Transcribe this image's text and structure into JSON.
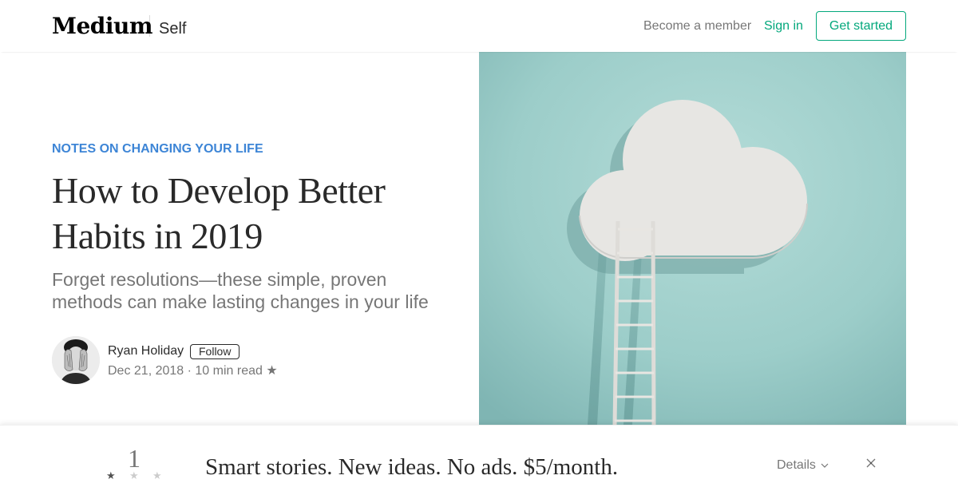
{
  "header": {
    "logo": "Medium",
    "publication": "Self",
    "become_member": "Become a member",
    "sign_in": "Sign in",
    "get_started": "Get started"
  },
  "article": {
    "kicker": "NOTES ON CHANGING YOUR LIFE",
    "title": "How to Develop Better Habits in 2019",
    "subtitle": "Forget resolutions—these simple, proven methods can make lasting changes in your life",
    "author": "Ryan Holiday",
    "follow_label": "Follow",
    "meta": "Dec 21, 2018 · 10 min read ★"
  },
  "banner": {
    "count": "1",
    "stars": [
      "★",
      "★",
      "★"
    ],
    "text": "Smart stories. New ideas. No ads. $5/month.",
    "details_label": "Details"
  },
  "icons": {
    "star": "star-icon",
    "chevron": "chevron-down-icon",
    "close": "close-icon"
  },
  "colors": {
    "accent_green": "#03a87c",
    "kicker_blue": "#3d85d6",
    "image_bg": "#9fcfcc"
  }
}
